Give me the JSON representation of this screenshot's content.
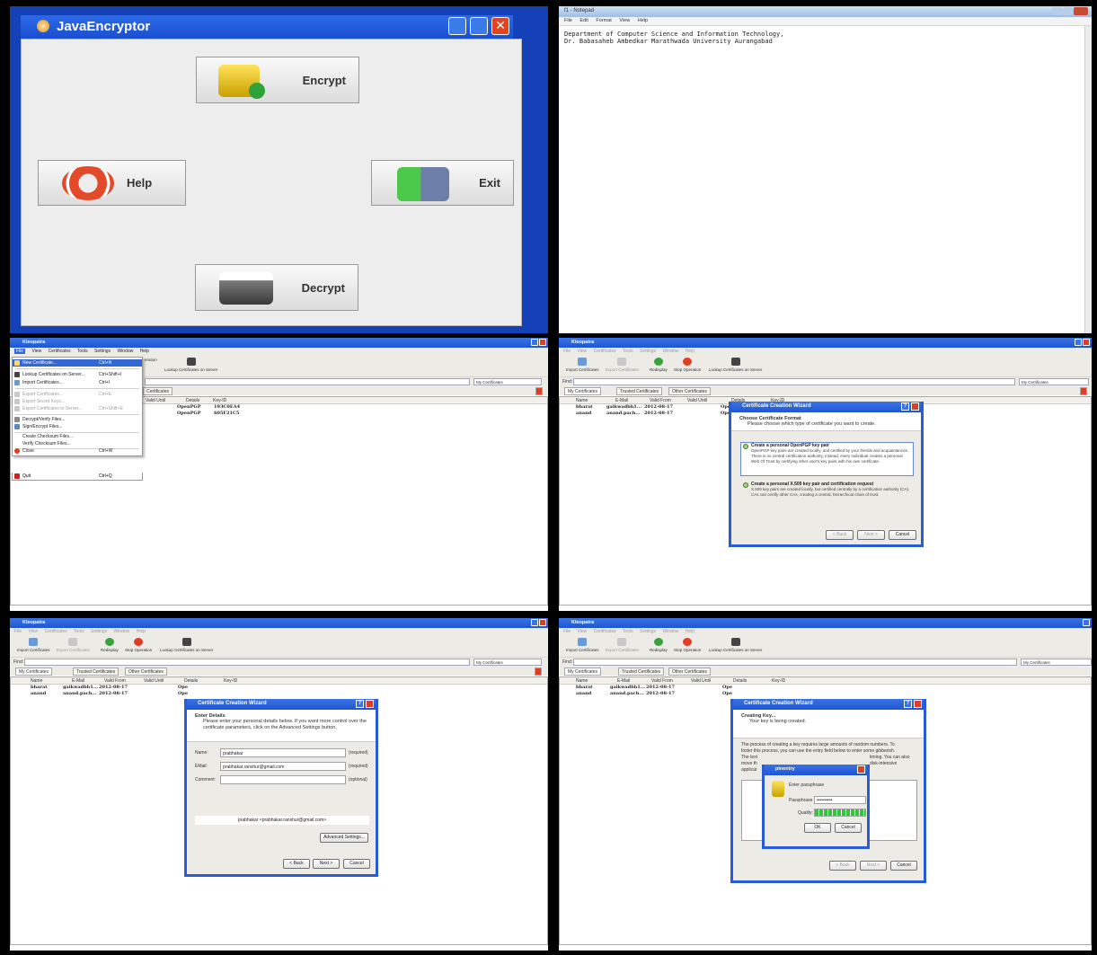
{
  "java_encryptor": {
    "title": "JavaEncryptor",
    "buttons": {
      "encrypt": "Encrypt",
      "help": "Help",
      "exit": "Exit",
      "decrypt": "Decrypt"
    }
  },
  "notepad": {
    "title": "f1 - Notepad",
    "menu": [
      "File",
      "Edit",
      "Format",
      "View",
      "Help"
    ],
    "lines": [
      "Department of Computer Science and Information Technology,",
      "Dr. Babasaheb Ambedkar Marathwada University Aurangabad"
    ]
  },
  "kleopatra": {
    "title": "Kleopatra",
    "menu": [
      "File",
      "View",
      "Certificates",
      "Tools",
      "Settings",
      "Window",
      "Help"
    ],
    "toolbar": [
      "Import Certificates",
      "Export Certificates",
      "Redisplay",
      "Stop Operation",
      "Lookup Certificates on Server"
    ],
    "toolbar_partial": "eration",
    "find_label": "Find:",
    "scope": "My Certificates",
    "tabs": [
      "My Certificates",
      "Trusted Certificates",
      "Other Certificates"
    ],
    "tab_partial": "Certificates",
    "columns": [
      "Name",
      "E-Mail",
      "Valid From",
      "Valid Until",
      "Details",
      "Key-ID"
    ],
    "rows": [
      {
        "name": "bharat",
        "email": "gaikwadbh1...",
        "valid_from": "2012-08-17",
        "details": "OpenPGP",
        "key_id": "193C0EA4"
      },
      {
        "name": "anand",
        "email": "anand.pach...",
        "valid_from": "2012-08-17",
        "details": "OpenPGP",
        "key_id": "605F21C5"
      }
    ],
    "details_partial": [
      "Ope",
      "Ope"
    ]
  },
  "file_menu": {
    "items": [
      {
        "label": "New Certificate...",
        "shortcut": "Ctrl+N",
        "state": "highlighted"
      },
      {
        "label": "Lookup Certificates on Server...",
        "shortcut": "Ctrl+Shift+I",
        "state": "enabled"
      },
      {
        "label": "Import Certificates...",
        "shortcut": "Ctrl+I",
        "state": "enabled"
      },
      {
        "label": "Export Certificates...",
        "shortcut": "Ctrl+E",
        "state": "disabled"
      },
      {
        "label": "Export Secret Keys...",
        "shortcut": "",
        "state": "disabled"
      },
      {
        "label": "Export Certificates to Server...",
        "shortcut": "Ctrl+Shift+E",
        "state": "disabled"
      },
      {
        "label": "Decrypt/Verify Files...",
        "shortcut": "",
        "state": "enabled"
      },
      {
        "label": "Sign/Encrypt Files...",
        "shortcut": "",
        "state": "enabled"
      },
      {
        "label": "Create Checksum Files...",
        "shortcut": "",
        "state": "enabled"
      },
      {
        "label": "Verify Checksum Files...",
        "shortcut": "",
        "state": "enabled"
      },
      {
        "label": "Close",
        "shortcut": "Ctrl+W",
        "state": "enabled"
      },
      {
        "label": "Quit",
        "shortcut": "Ctrl+Q",
        "state": "enabled"
      }
    ]
  },
  "wizard_format": {
    "title": "Certificate Creation Wizard",
    "heading": "Choose Certificate Format",
    "subheading": "Please choose which type of certificate you want to create.",
    "option1_title": "Create a personal OpenPGP key pair",
    "option1_text": "OpenPGP key pairs are created locally, and certified by your friends and acquaintances. There is no central certification authority; instead, every individual creates a personal Web Of Trust by certifying other user's key pairs with his own certificate.",
    "option2_title": "Create a personal X.509 key pair and certification request",
    "option2_text": "X.509 key pairs are created locally, but certified centrally by a certification authority (CA). CAs can certify other CAs, creating a central, hierarchical chain of trust.",
    "back": "< Back",
    "next": "Next >",
    "cancel": "Cancel"
  },
  "wizard_details": {
    "title": "Certificate Creation Wizard",
    "heading": "Enter Details",
    "subheading": "Please enter your personal details below. If you want more control over the certificate parameters, click on the Advanced Settings button.",
    "name_label": "Name:",
    "name_value": "prabhakar",
    "name_note": "(required)",
    "email_label": "EMail:",
    "email_value": "prabhakar.ranshur@gmail.com",
    "email_note": "(required)",
    "comment_label": "Comment:",
    "comment_value": "",
    "comment_note": "(optional)",
    "preview": "prabhakar <prabhakar.ranshur@gmail.com>",
    "advanced": "Advanced Settings...",
    "back": "< Back",
    "next": "Next >",
    "cancel": "Cancel"
  },
  "wizard_creating": {
    "title": "Certificate Creation Wizard",
    "heading": "Creating Key...",
    "subheading": "Your key is being created.",
    "body": [
      "The process of creating a key requires large amounts of random numbers. To",
      "foster this process, you can use the entry field below to enter some gibberish.",
      "The text",
      "timing. You can also",
      "move th",
      "disk-intensive",
      "applicat"
    ],
    "back": "< Back",
    "next": "Next >",
    "cancel": "Cancel"
  },
  "pinentry": {
    "title": "pinentry",
    "prompt": "Enter passphrase",
    "passphrase_label": "Passphrase",
    "passphrase_value": "••••••••••",
    "quality_label": "Quality:",
    "quality_level": 1.0,
    "ok": "OK",
    "cancel": "Cancel"
  }
}
